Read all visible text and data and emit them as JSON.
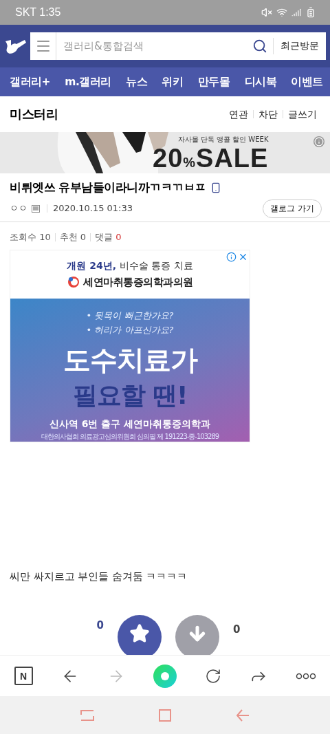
{
  "status_bar": {
    "carrier_time": "SKT 1:35"
  },
  "search": {
    "placeholder": "갤러리&통합검색",
    "recent_button": "최근방문"
  },
  "nav_tabs": [
    {
      "label": "갤러리+"
    },
    {
      "label": "m.갤러리"
    },
    {
      "label": "뉴스"
    },
    {
      "label": "위키"
    },
    {
      "label": "만두몰"
    },
    {
      "label": "디시북"
    },
    {
      "label": "이벤트"
    }
  ],
  "gallery": {
    "title": "미스터리",
    "actions": [
      "연관",
      "차단",
      "글쓰기"
    ]
  },
  "banner_ad": {
    "kicker": "자사몰 단독 앵콜 할인 WEEK",
    "number": "20",
    "percent": "%",
    "word": "SALE"
  },
  "post": {
    "title": "비튀엣쓰 유부남들이라니까ㄲㅋㄲㅂㅍ",
    "author": "ㅇㅇ",
    "date": "2020.10.15 01:33",
    "gallog_button": "갤로그 가기",
    "stats": [
      {
        "label": "조회수",
        "value": "10",
        "highlight": false
      },
      {
        "label": "추천",
        "value": "0",
        "highlight": false
      },
      {
        "label": "댓글",
        "value": "0",
        "highlight": true
      }
    ]
  },
  "ad": {
    "top_line_bold": "개원 24년,",
    "top_line": "비수술 통증 치료",
    "clinic": "세연마취통증의학과의원",
    "questions": [
      "• 뒷목이 뻐근한가요?",
      "• 허리가 아프신가요?"
    ],
    "headline": "도수치료가",
    "subheadline": "필요할 땐!",
    "location": "신사역 6번 출구 세연마취통증의학과",
    "disclaimer": "대한의사협회 의료광고심의위원회 심의필 제 191223-중-103289"
  },
  "body": "씨만 싸지르고 부인들 숨겨둠 ㅋㅋㅋㅋ",
  "votes": {
    "up": "0",
    "down": "0"
  },
  "browser_toolbar": {
    "home_label": "N",
    "forward_disabled": true
  }
}
